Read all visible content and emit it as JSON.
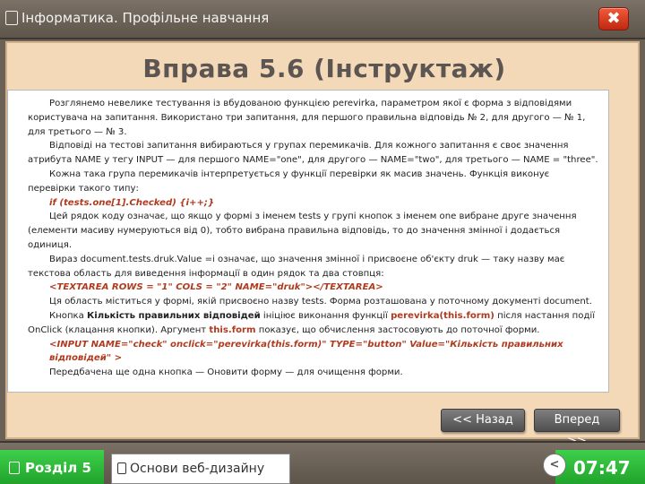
{
  "window": {
    "title": "Інформатика. Профільне навчання",
    "close_label": "✖"
  },
  "slide": {
    "title": "Вправа 5.6 (Інструктаж)",
    "paragraphs": {
      "p1": "Розглянемо невелике тестування із вбудованою функцією perevirka, параметром якої є форма з відповідями користувача на запитання. Використано три запитання, для першого правильна відповідь № 2, для другого — № 1, для третього — № 3.",
      "p2": "Відповіді на тестові запитання вибираються у групах перемикачів. Для кожного запитання є своє значення атрибута NAME у тегу INPUT — для першого NAME=\"one\", для другого — NAME=\"two\", для третього — NAME = \"three\".",
      "p3": "Кожна така група перемикачів інтерпретується у функції перевірки як масив значень. Функція виконує перевірки такого типу:",
      "code1": "if (tests.one[1].Checked) {i++;}",
      "p4": "Цей рядок коду означає, що якщо у формі з іменем tests у групі кнопок з іменем one вибране друге значення (елементи масиву нумеруються від 0), тобто вибрана правильна відповідь, то до значення змінної і додається одиниця.",
      "p5": "Вираз document.tests.druk.Value =i означає, що значення змінної і присвоєне об'єкту druk — таку назву має текстова область для виведення інформації в один рядок та два стовпця:",
      "code2": "<TEXTAREA ROWS = \"1\" COLS = \"2\" NAME=\"druk\"></TEXTAREA>",
      "p6": "Ця область міститься у формі, якій присвоєно назву tests. Форма розташована у поточному документі document.",
      "p7_a": "Кнопка ",
      "p7_b": "Кількість правильних відповідей",
      "p7_c": " ініціює виконання функції ",
      "p7_d": "perevirka(this.form)",
      "p7_e": " після настання події OnClick (клацання кнопки). Аргумент ",
      "p7_f": "this.form",
      "p7_g": " показує, що обчислення застосовують до поточної форми.",
      "code3": "<INPUT NAME=\"check\" onclick=\"perevirka(this.form)\" TYPE=\"button\" Value=\"Кількість правильних відповідей\" >",
      "p8": "Передбачена ще одна кнопка — Оновити форму — для очищення форми."
    },
    "back_label": "<< Назад",
    "next_label": "Вперед >>"
  },
  "footer": {
    "section_label": "Розділ 5",
    "course_label": "Основи веб-дизайну",
    "back_circle_label": "<",
    "clock": "07:47"
  },
  "colors": {
    "slide_bg": "#f4d9b8",
    "accent_green": "#2bb838",
    "code_red": "#b03a1e",
    "close_red": "#d83a1c"
  }
}
